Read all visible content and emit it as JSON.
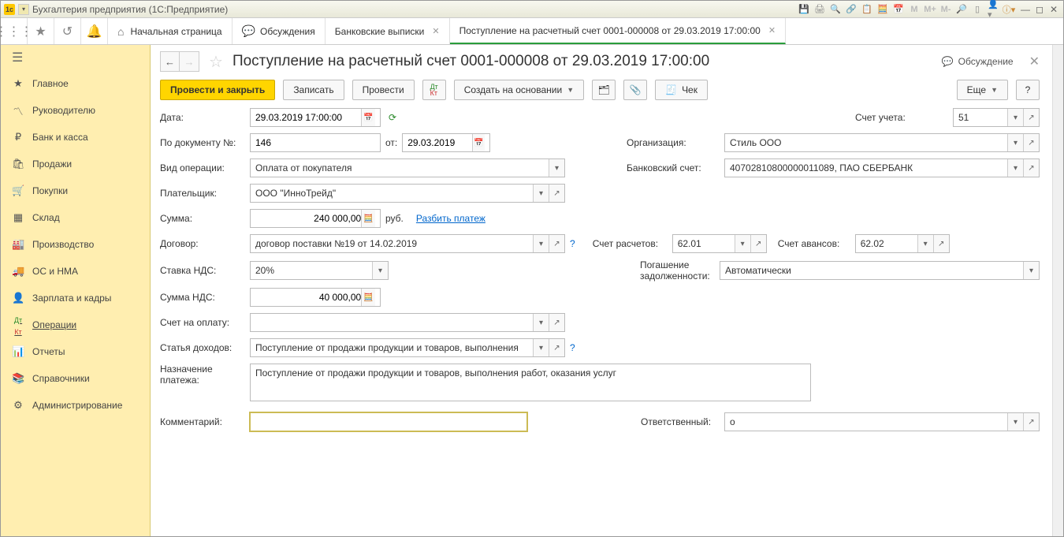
{
  "titlebar": {
    "title": "Бухгалтерия предприятия  (1С:Предприятие)",
    "markers": [
      "M",
      "M+",
      "M-"
    ]
  },
  "tabs": {
    "home": "Начальная страница",
    "discussions": "Обсуждения",
    "bank": "Банковские выписки",
    "doc": "Поступление на расчетный счет 0001-000008 от 29.03.2019 17:00:00"
  },
  "sidebar": {
    "items": [
      {
        "id": "main",
        "icon": "≡",
        "label": "Главное"
      },
      {
        "id": "mgr",
        "icon": "📈",
        "label": "Руководителю"
      },
      {
        "id": "bank",
        "icon": "₽",
        "label": "Банк и касса"
      },
      {
        "id": "sales",
        "icon": "🛍",
        "label": "Продажи"
      },
      {
        "id": "purch",
        "icon": "🛒",
        "label": "Покупки"
      },
      {
        "id": "stock",
        "icon": "▦",
        "label": "Склад"
      },
      {
        "id": "prod",
        "icon": "🏭",
        "label": "Производство"
      },
      {
        "id": "os",
        "icon": "🚚",
        "label": "ОС и НМА"
      },
      {
        "id": "hr",
        "icon": "👤",
        "label": "Зарплата и кадры"
      },
      {
        "id": "ops",
        "icon": "ДК",
        "label": "Операции"
      },
      {
        "id": "rep",
        "icon": "📊",
        "label": "Отчеты"
      },
      {
        "id": "ref",
        "icon": "📚",
        "label": "Справочники"
      },
      {
        "id": "admin",
        "icon": "⚙",
        "label": "Администрирование"
      }
    ]
  },
  "header": {
    "title": "Поступление на расчетный счет 0001-000008 от 29.03.2019 17:00:00",
    "discussion": "Обсуждение"
  },
  "cmd": {
    "post_close": "Провести и закрыть",
    "save": "Записать",
    "post": "Провести",
    "create_based": "Создать на основании",
    "check": "Чек",
    "more": "Еще"
  },
  "form": {
    "date_label": "Дата:",
    "date_value": "29.03.2019 17:00:00",
    "docnum_label": "По документу №:",
    "docnum_value": "146",
    "docnum_from": "от:",
    "docnum_date": "29.03.2019",
    "account_label": "Счет учета:",
    "account_value": "51",
    "org_label": "Организация:",
    "org_value": "Стиль ООО",
    "optype_label": "Вид операции:",
    "optype_value": "Оплата от покупателя",
    "bankacc_label": "Банковский счет:",
    "bankacc_value": "40702810800000011089, ПАО СБЕРБАНК",
    "payer_label": "Плательщик:",
    "payer_value": "ООО \"ИнноТрейд\"",
    "sum_label": "Сумма:",
    "sum_value": "240 000,00",
    "sum_cur": "руб.",
    "split": "Разбить платеж",
    "contract_label": "Договор:",
    "contract_value": "договор поставки №19 от 14.02.2019",
    "acc_calc_label": "Счет расчетов:",
    "acc_calc_value": "62.01",
    "acc_adv_label": "Счет авансов:",
    "acc_adv_value": "62.02",
    "vat_label": "Ставка НДС:",
    "vat_value": "20%",
    "debt_label1": "Погашение",
    "debt_label2": "задолженности:",
    "debt_value": "Автоматически",
    "vat_sum_label": "Сумма НДС:",
    "vat_sum_value": "40 000,00",
    "invoice_label": "Счет на оплату:",
    "income_label": "Статья доходов:",
    "income_value": "Поступление от продажи продукции и товаров, выполнения",
    "purpose_label1": "Назначение",
    "purpose_label2": "платежа:",
    "purpose_value": "Поступление от продажи продукции и товаров, выполнения работ, оказания услуг",
    "comment_label": "Комментарий:",
    "resp_label": "Ответственный:",
    "resp_value": "o"
  }
}
